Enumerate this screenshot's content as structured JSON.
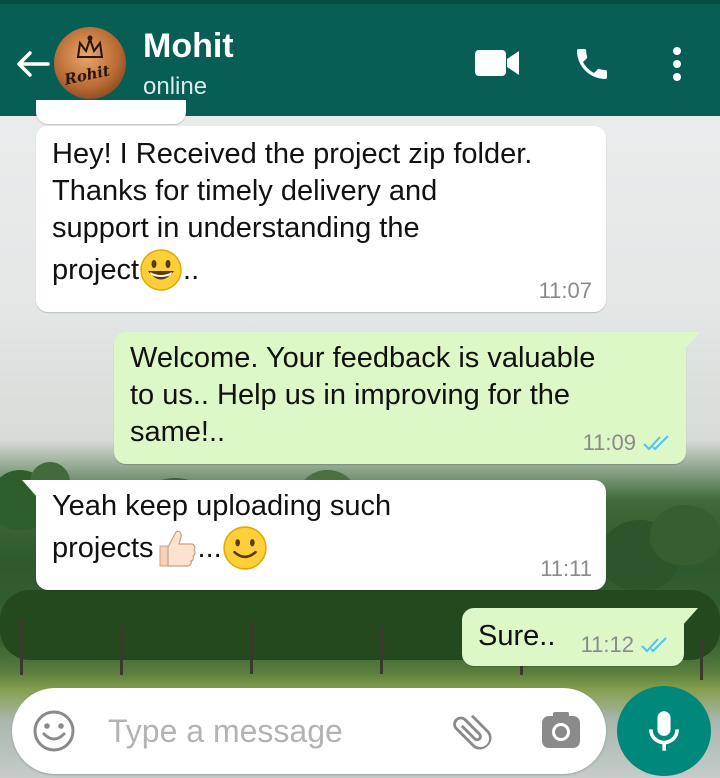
{
  "header": {
    "contact_name": "Mohit",
    "contact_status": "online",
    "avatar_text": "Rohit",
    "icons": [
      "back-arrow-icon",
      "video-call-icon",
      "phone-icon",
      "more-vert-icon"
    ]
  },
  "messages": [
    {
      "direction": "incoming",
      "lines": [
        "Hey! I Received the project zip folder.",
        "Thanks for timely delivery and",
        "support in understanding the",
        "project"
      ],
      "trailing": "..",
      "emoji": [
        "grinning-face"
      ],
      "time": "11:07"
    },
    {
      "direction": "outgoing",
      "lines": [
        "Welcome. Your feedback is valuable",
        "to us.. Help us in improving for the",
        "same!.."
      ],
      "time": "11:09",
      "status": "read"
    },
    {
      "direction": "incoming",
      "lines": [
        "Yeah keep uploading such",
        "projects"
      ],
      "trailing": "...",
      "emoji": [
        "thumbs-up",
        "smiling-face"
      ],
      "time": "11:11"
    },
    {
      "direction": "outgoing",
      "lines": [
        "Sure.."
      ],
      "time": "11:12",
      "status": "read"
    }
  ],
  "composer": {
    "placeholder": "Type a message",
    "icons": [
      "emoji-icon",
      "attach-icon",
      "camera-icon",
      "mic-icon"
    ]
  },
  "colors": {
    "header": "#075e54",
    "outgoing_bubble": "#dcf8c6",
    "incoming_bubble": "#ffffff",
    "read_ticks": "#4fc3f7",
    "mic_button": "#00897b"
  }
}
